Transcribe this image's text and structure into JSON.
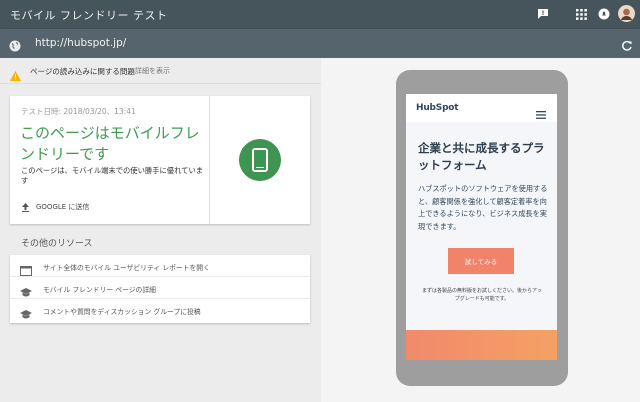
{
  "appbar": {
    "title": "モバイル フレンドリー テスト",
    "icons": [
      "feedback-icon",
      "apps-grid-icon",
      "notifications-icon",
      "avatar"
    ]
  },
  "urlbar": {
    "url": "http://hubspot.jp/"
  },
  "warning": {
    "text": "ページの読み込みに関する問題",
    "link": "詳細を表示"
  },
  "result": {
    "date": "テスト日時: 2018/03/20、13:41",
    "headline": "このページはモバイルフレンドリーです",
    "description": "このページは、モバイル端末での使い勝手に優れています",
    "share_label": "GOOGLE に送信",
    "status_color": "#3e9450"
  },
  "resources": {
    "title": "その他のリソース",
    "items": [
      {
        "icon": "browser-window-icon",
        "label": "サイト全体のモバイル ユーザビリティ レポートを開く"
      },
      {
        "icon": "graduation-cap-icon",
        "label": "モバイル フレンドリー ページの詳細"
      },
      {
        "icon": "graduation-cap-icon",
        "label": "コメントや質問をディスカッション グループに投稿"
      }
    ]
  },
  "preview": {
    "logo": "HubSpot",
    "hero": "企業と共に成長するプラットフォーム",
    "body": "ハブスポットのソフトウェアを使用すると、顧客関係を強化して顧客定着率を向上できるようになり、ビジネス成長を実現できます。",
    "cta": "試してみる",
    "note": "まずは各製品の無料版をお試しください。後からアップグレードも可能です。",
    "accent": "#f0836a"
  }
}
